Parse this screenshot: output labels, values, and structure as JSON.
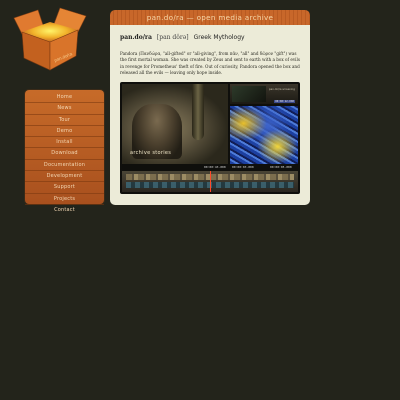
{
  "logo": {
    "icon": "open-cardboard-box-icon",
    "box_text": "pan.do/ra"
  },
  "header": {
    "title": "pan.do/ra — open media archive"
  },
  "sidebar": {
    "items": [
      {
        "label": "Home"
      },
      {
        "label": "News"
      },
      {
        "label": "Tour"
      },
      {
        "label": "Demo"
      },
      {
        "label": "Install"
      },
      {
        "label": "Download"
      },
      {
        "label": "Documentation"
      },
      {
        "label": "Development"
      },
      {
        "label": "Support"
      },
      {
        "label": "Projects"
      },
      {
        "label": "Contact"
      }
    ]
  },
  "definition": {
    "word": "pan.do/ra",
    "pronunciation": "[pan dôrə]",
    "category": "Greek Mythology",
    "text": "Pandora (Πανδώρα, \"all-gifted\" or \"all-giving\", from πᾶν, \"all\" and δῶρον \"gift\") was the first mortal woman. She was created by Zeus and sent to earth with a box of evils in revenge for Prometheus' theft of fire. Out of curiosity, Pandora opened the box and released all the evils — leaving only hope inside."
  },
  "screenshot": {
    "left_label": "archive stories",
    "thumb_label": "pan.do/ra screening",
    "thumb_timecode": "00:00:12.000",
    "left_timecode": "00:00:43.000",
    "right_timecode": "00:00:03.000",
    "far_timecode": "00:00:05.000"
  }
}
